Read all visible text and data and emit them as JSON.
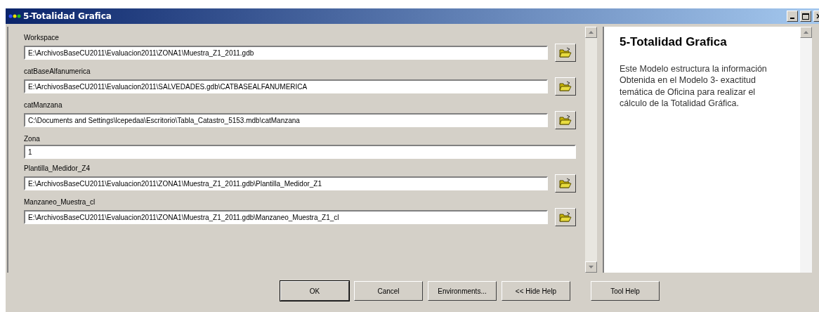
{
  "window": {
    "title": "5-Totalidad Grafica"
  },
  "parameters": [
    {
      "label": "Workspace",
      "value": "E:\\ArchivosBaseCU2011\\Evaluacion2011\\ZONA1\\Muestra_Z1_2011.gdb",
      "kind": "path"
    },
    {
      "label": "catBaseAlfanumerica",
      "value": "E:\\ArchivosBaseCU2011\\Evaluacion2011\\SALVEDADES.gdb\\CATBASEALFANUMERICA",
      "kind": "path"
    },
    {
      "label": "catManzana",
      "value": "C:\\Documents and Settings\\lcepedaa\\Escritorio\\Tabla_Catastro_5153.mdb\\catManzana",
      "kind": "path"
    },
    {
      "label": "Zona",
      "value": "1",
      "kind": "text"
    },
    {
      "label": "Plantilla_Medidor_Z4",
      "value": "E:\\ArchivosBaseCU2011\\Evaluacion2011\\ZONA1\\Muestra_Z1_2011.gdb\\Plantilla_Medidor_Z1",
      "kind": "path"
    },
    {
      "label": "Manzaneo_Muestra_cl",
      "value": "E:\\ArchivosBaseCU2011\\Evaluacion2011\\ZONA1\\Muestra_Z1_2011.gdb\\Manzaneo_Muestra_Z1_cl",
      "kind": "path"
    }
  ],
  "help": {
    "title": "5-Totalidad Grafica",
    "text": "Este Modelo estructura la información Obtenida en el Modelo 3- exactitud temática de Oficina para realizar el cálculo de la Totalidad Gráfica."
  },
  "buttons": [
    "OK",
    "Cancel",
    "Environments...",
    "<< Hide Help",
    "Tool Help"
  ]
}
